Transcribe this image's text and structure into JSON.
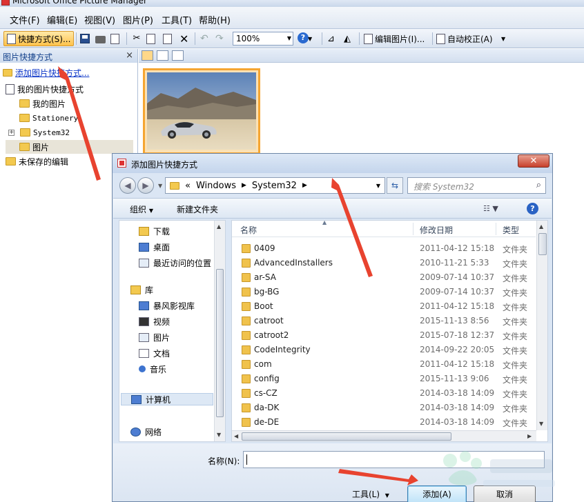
{
  "app": {
    "title": "Microsoft Office Picture Manager",
    "menu": [
      "文件(F)",
      "编辑(E)",
      "视图(V)",
      "图片(P)",
      "工具(T)",
      "帮助(H)"
    ],
    "toolbar": {
      "shortcuts_label": "快捷方式(S)...",
      "zoom_value": "100%",
      "edit_pictures_label": "编辑图片(I)...",
      "auto_correct_label": "自动校正(A)"
    }
  },
  "left_pane": {
    "header": "图片快捷方式",
    "close_glyph": "×",
    "add_link": "添加图片快捷方式...",
    "tree": [
      {
        "label": "我的图片快捷方式"
      },
      {
        "label": "我的图片"
      },
      {
        "label": "Stationery"
      },
      {
        "label": "System32",
        "expand": "+"
      },
      {
        "label": "图片",
        "selected": true
      },
      {
        "label": "未保存的编辑"
      }
    ]
  },
  "dialog": {
    "title": "添加图片快捷方式",
    "close_glyph": "✕",
    "address": {
      "prefix": "«",
      "crumbs": [
        "Windows",
        "System32"
      ]
    },
    "search_placeholder": "搜索 System32",
    "commands": {
      "organize": "组织",
      "new_folder": "新建文件夹"
    },
    "nav": {
      "favorites": [
        {
          "label": "下载",
          "icon": "download-folder-icon"
        },
        {
          "label": "桌面",
          "icon": "desktop-icon"
        },
        {
          "label": "最近访问的位置",
          "icon": "recent-places-icon"
        }
      ],
      "libraries_label": "库",
      "libraries": [
        {
          "label": "暴风影视库",
          "icon": "video-library-icon"
        },
        {
          "label": "视频",
          "icon": "video-icon"
        },
        {
          "label": "图片",
          "icon": "pictures-icon"
        },
        {
          "label": "文档",
          "icon": "documents-icon"
        },
        {
          "label": "音乐",
          "icon": "music-icon"
        }
      ],
      "computer": "计算机",
      "network": "网络"
    },
    "columns": {
      "name": "名称",
      "date": "修改日期",
      "type": "类型"
    },
    "files": [
      {
        "name": "0409",
        "date": "2011-04-12 15:18",
        "type": "文件夹"
      },
      {
        "name": "AdvancedInstallers",
        "date": "2010-11-21 5:33",
        "type": "文件夹"
      },
      {
        "name": "ar-SA",
        "date": "2009-07-14 10:37",
        "type": "文件夹"
      },
      {
        "name": "bg-BG",
        "date": "2009-07-14 10:37",
        "type": "文件夹"
      },
      {
        "name": "Boot",
        "date": "2011-04-12 15:18",
        "type": "文件夹"
      },
      {
        "name": "catroot",
        "date": "2015-11-13 8:56",
        "type": "文件夹"
      },
      {
        "name": "catroot2",
        "date": "2015-07-18 12:37",
        "type": "文件夹"
      },
      {
        "name": "CodeIntegrity",
        "date": "2014-09-22 20:05",
        "type": "文件夹"
      },
      {
        "name": "com",
        "date": "2011-04-12 15:18",
        "type": "文件夹"
      },
      {
        "name": "config",
        "date": "2015-11-13 9:06",
        "type": "文件夹"
      },
      {
        "name": "cs-CZ",
        "date": "2014-03-18 14:09",
        "type": "文件夹"
      },
      {
        "name": "da-DK",
        "date": "2014-03-18 14:09",
        "type": "文件夹"
      },
      {
        "name": "de-DE",
        "date": "2014-03-18 14:09",
        "type": "文件夹"
      }
    ],
    "filename_label": "名称(N):",
    "filename_value": "",
    "tools_label": "工具(L)",
    "ok_label": "添加(A)",
    "cancel_label": "取消"
  },
  "colors": {
    "accent": "#f5a531",
    "arrow": "#e8432f",
    "link": "#0a34c8"
  }
}
